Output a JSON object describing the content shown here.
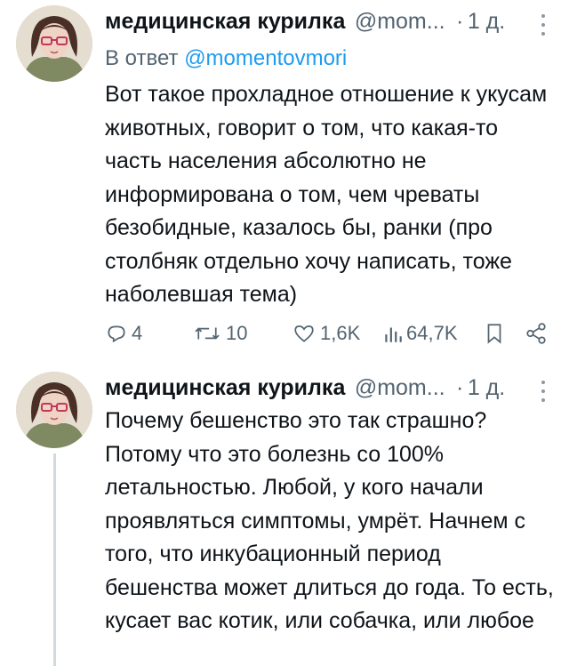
{
  "tweets": [
    {
      "author_name": "медицинская курилка",
      "handle": "@mom...",
      "dot": "·",
      "time": "1 д.",
      "reply_prefix": "В ответ ",
      "reply_handle": "@momentovmori",
      "text": "Вот такое прохладное отношение к укусам животных, говорит о том, что какая-то часть населения абсолютно не информирована о том, чем чреваты безобидные, казалось бы, ранки (про столбняк отдельно хочу написать, тоже наболевшая тема)",
      "stats": {
        "replies": "4",
        "retweets": "10",
        "likes": "1,6K",
        "views": "64,7K"
      },
      "icons": [
        "reply-icon",
        "retweet-icon",
        "like-icon",
        "views-icon",
        "bookmark-icon",
        "share-icon",
        "more-icon"
      ]
    },
    {
      "author_name": "медицинская курилка",
      "handle": "@mom...",
      "dot": "·",
      "time": "1 д.",
      "text": "Почему бешенство это так страшно? Потому что это болезнь со 100% летальностью. Любой, у кого начали проявляться симптомы, умрёт. Начнем с того, что инкубационный период бешенства может длиться до года. То есть, кусает вас  котик, или собачка, или любое",
      "icons": [
        "more-icon"
      ]
    }
  ],
  "colors": {
    "text": "#0f1419",
    "secondary": "#536471",
    "link": "#1d9bf0",
    "thread_line": "#cfd9de"
  }
}
